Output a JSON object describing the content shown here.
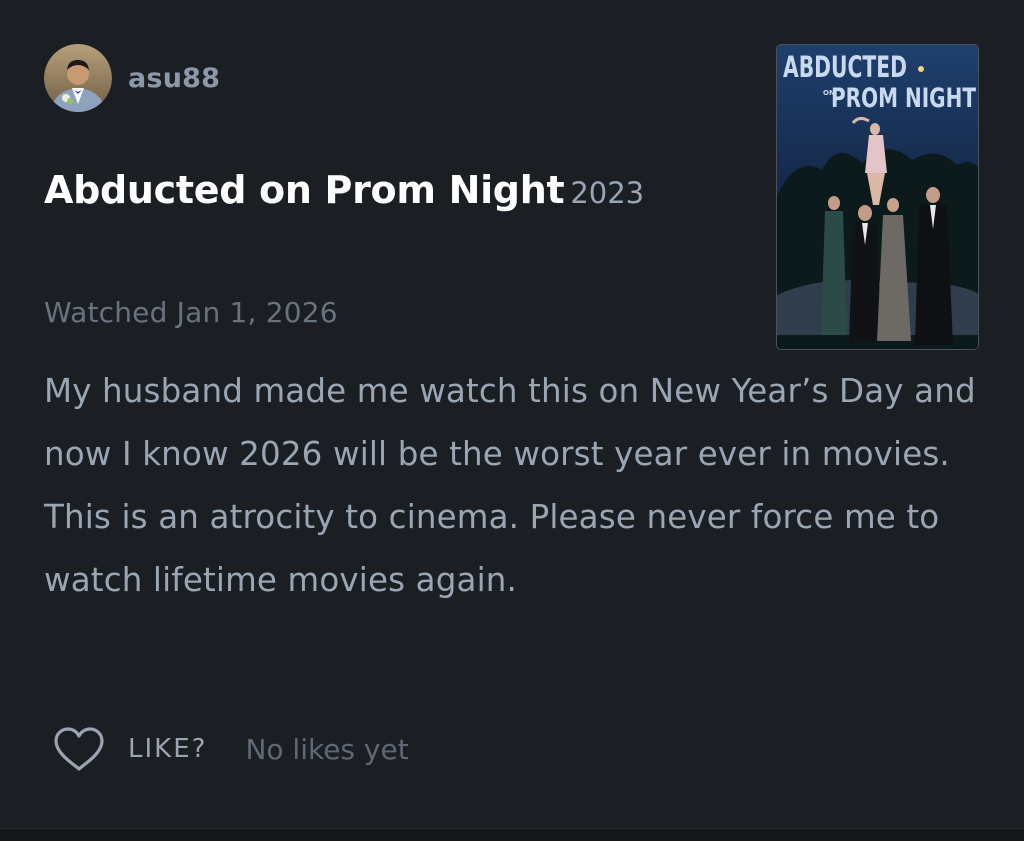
{
  "review": {
    "author": {
      "username": "asu88",
      "avatar_icon": "user-avatar-photo"
    },
    "film": {
      "title": "Abducted on Prom Night",
      "year": "2023",
      "poster": {
        "title_line1": "ABDUCTED",
        "title_small": "ON",
        "title_line2": "PROM NIGHT"
      }
    },
    "watched_label": "Watched Jan 1, 2026",
    "body": "My husband made me watch this on New Year’s Day and now I know 2026 will be the worst year ever in movies. This is an atrocity to cinema. Please never force me to watch lifetime movies again.",
    "actions": {
      "like_icon": "heart-outline-icon",
      "like_label": "LIKE?",
      "likes_text": "No likes yet"
    }
  },
  "colors": {
    "background": "#1b1e23",
    "title": "#ffffff",
    "body_text": "#9ba6b5",
    "muted": "#69737f"
  }
}
